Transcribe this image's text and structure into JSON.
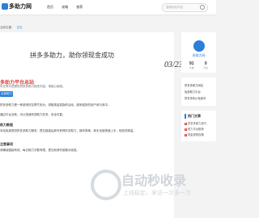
{
  "header": {
    "logo": "多助力网",
    "nav": [
      "首页",
      "攻略",
      "推荐"
    ],
    "search_placeholder": "搜索相关内容"
  },
  "breadcrumb": {
    "text": "当前位置：",
    "tag": "正文"
  },
  "article": {
    "title": "拼多多助力，助你领现金成功",
    "date": "03/23",
    "author": "多助力平台总站",
    "meta": "本文章为您提供拼多多助力相关内容，请放心使用。",
    "button": "点我助力",
    "p1": "拼多多助力是一种邀请好友帮忙砍价、领取现金奖励的活动，越来越多的用户参与其中。",
    "p2": "通过平台互助，可以快速完成助力任务，安全可靠。",
    "sub1": "助力教程",
    "p3": "本站免费提供拼多多助力服务，提交链接后即可获得好友助力，操作简单，新手也能快速上手，轻松领现金。",
    "sub2": "注意事项",
    "p4": "请确保链接有效，每日助力次数有限，提交前请仔细核对信息。"
  },
  "sidebar": {
    "username": "多助力网",
    "stats": [
      {
        "n": "91",
        "l": "文章"
      },
      {
        "n": "0",
        "l": "评论"
      }
    ],
    "links": [
      "拼多多助力网站",
      "免费助力平台",
      "拼多多砍价免费拿"
    ],
    "hot_title": "热门文章",
    "hot": [
      "拼多多助力技巧",
      "助力平台推荐",
      "现金提现攻略"
    ]
  },
  "watermark": {
    "brand": "自动秒收录",
    "slogan": "上线稳定，来访一次多一次"
  }
}
